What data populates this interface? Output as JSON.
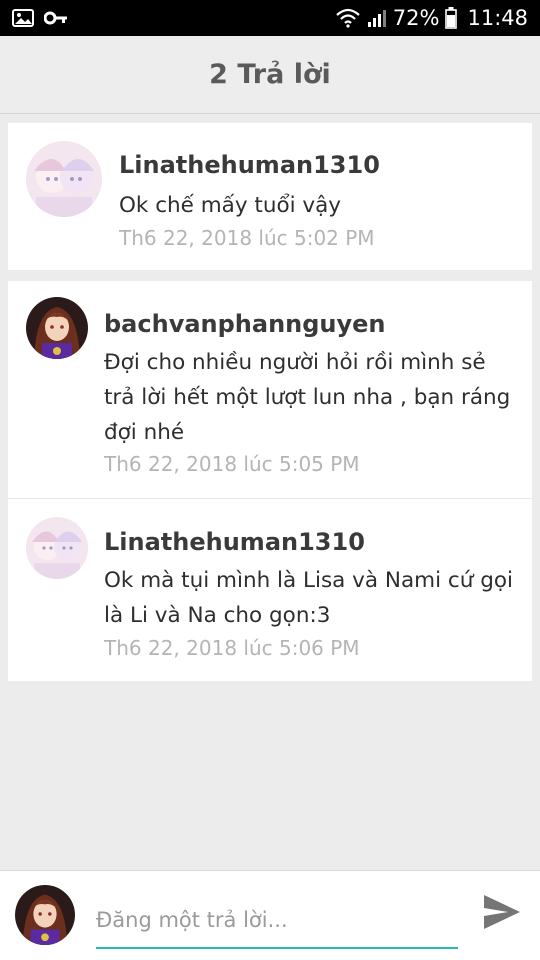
{
  "status": {
    "battery": "72%",
    "time": "11:48"
  },
  "header": {
    "title": "2 Trả lời"
  },
  "comments": [
    {
      "author": "Linathehuman1310",
      "text": "Ok chế mấy tuổi vậy",
      "time": "Th6 22, 2018 lúc 5:02 PM"
    },
    {
      "author": "bachvanphannguyen",
      "text": "Đợi cho nhiều người hỏi rồi mình sẻ trả lời hết một lượt lun nha , bạn ráng đợi nhé",
      "time": "Th6 22, 2018 lúc 5:05 PM"
    },
    {
      "author": "Linathehuman1310",
      "text": "Ok mà tụi mình là Lisa và Nami cứ gọi là Li và Na cho gọn:3",
      "time": "Th6 22, 2018 lúc 5:06 PM"
    }
  ],
  "compose": {
    "placeholder": "Đăng một trả lời..."
  },
  "colors": {
    "accent": "#2bb7b3",
    "header_bg": "#ededed",
    "page_bg": "#ececec"
  },
  "icons": [
    "image-icon",
    "key-icon",
    "wifi-icon",
    "signal-icon",
    "battery-icon",
    "send-icon"
  ]
}
